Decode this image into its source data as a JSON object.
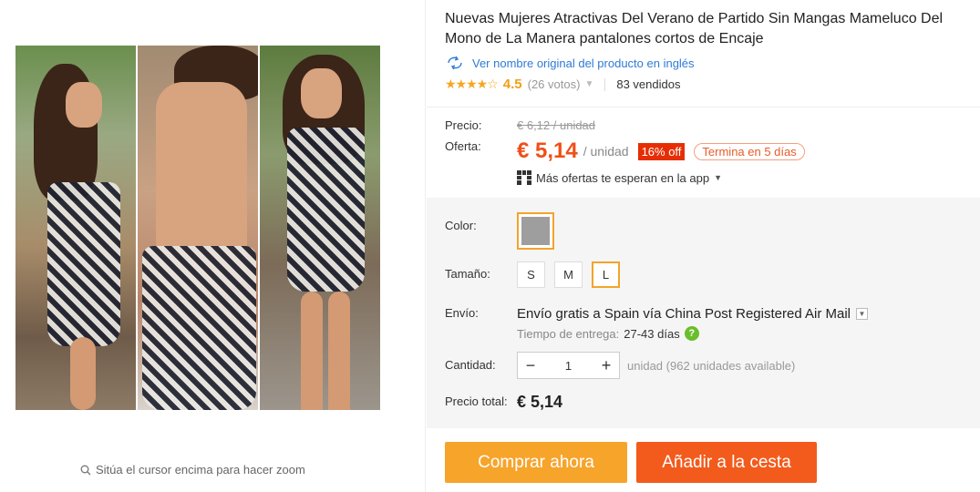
{
  "product": {
    "title": "Nuevas Mujeres Atractivas Del Verano de Partido Sin Mangas Mameluco Del Mono de La Manera pantalones cortos de Encaje",
    "translate_link": "Ver nombre original del producto en inglés",
    "rating_score": "4.5",
    "votes": "(26 votos)",
    "sold": "83 vendidos"
  },
  "price": {
    "label": "Precio:",
    "old": "€ 6,12 / unidad",
    "offer_label": "Oferta:",
    "current": "€ 5,14",
    "unit": "/ unidad",
    "discount": "16% off",
    "ends": "Termina en 5 días",
    "app_offers": "Más ofertas te esperan en la app"
  },
  "options": {
    "color_label": "Color:",
    "color_value": "#9e9e9e",
    "size_label": "Tamaño:",
    "sizes": [
      "S",
      "M",
      "L"
    ],
    "selected_size": "L"
  },
  "shipping": {
    "label": "Envío:",
    "main": "Envío gratis a Spain vía China Post Registered Air Mail",
    "time_label": "Tiempo de entrega:",
    "time_days": "27-43 días"
  },
  "quantity": {
    "label": "Cantidad:",
    "value": "1",
    "unit_info": "unidad (962 unidades available)"
  },
  "total": {
    "label": "Precio total:",
    "value": "€ 5,14"
  },
  "buttons": {
    "buy": "Comprar ahora",
    "cart": "Añadir a la cesta"
  },
  "gallery": {
    "zoom_hint": "Sitúa el cursor encima para hacer zoom"
  },
  "colors": {
    "accent_orange": "#f7a42b",
    "cart_orange": "#f25b1c",
    "price_red": "#f04f18",
    "link_blue": "#2e7bd6"
  }
}
